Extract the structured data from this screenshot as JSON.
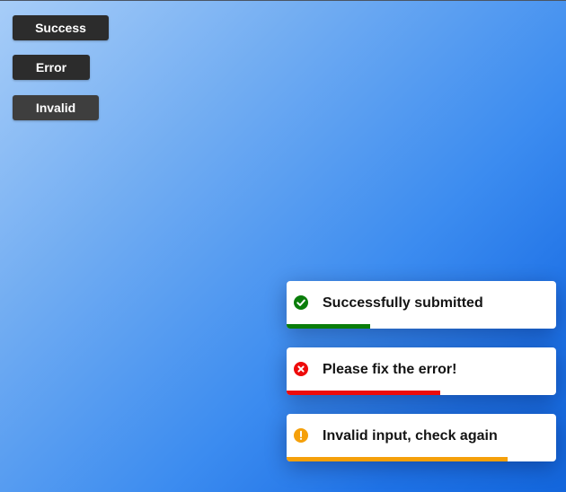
{
  "buttons": {
    "success_label": "Success",
    "error_label": "Error",
    "invalid_label": "Invalid"
  },
  "toasts": [
    {
      "type": "success",
      "icon": "check-circle-icon",
      "message": "Successfully submitted",
      "color": "#0a7d0a",
      "progress": 0.31
    },
    {
      "type": "error",
      "icon": "x-circle-icon",
      "message": "Please fix the error!",
      "color": "#ee0b0b",
      "progress": 0.57
    },
    {
      "type": "invalid",
      "icon": "exclamation-circle-icon",
      "message": "Invalid input, check again",
      "color": "#f5a00a",
      "progress": 0.82
    }
  ]
}
